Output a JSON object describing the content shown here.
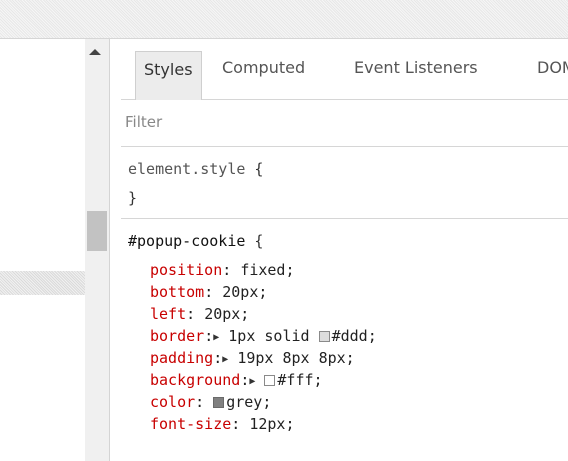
{
  "tabs": [
    {
      "label": "Styles"
    },
    {
      "label": "Computed"
    },
    {
      "label": "Event Listeners"
    },
    {
      "label": "DOM Breakpoints"
    }
  ],
  "filter": {
    "placeholder": "Filter",
    "value": ""
  },
  "element_style_rule": {
    "selector": "element.style",
    "open": " {",
    "close": "}"
  },
  "popup_rule": {
    "selector": "#popup-cookie",
    "open": " {",
    "declarations": [
      {
        "prop": "position",
        "value": "fixed;"
      },
      {
        "prop": "bottom",
        "value": "20px;"
      },
      {
        "prop": "left",
        "value": "20px;"
      },
      {
        "prop": "border",
        "value": "1px solid",
        "color_text": "#ddd;",
        "swatch_color": "#dddddd"
      },
      {
        "prop": "padding",
        "value": "19px 8px 8px;"
      },
      {
        "prop": "background",
        "color_text": "#fff;",
        "swatch_color": "#ffffff"
      },
      {
        "prop": "color",
        "color_text": "grey;",
        "swatch_color": "#808080"
      },
      {
        "prop": "font-size",
        "value": "12px;"
      }
    ]
  },
  "colors": {
    "property_name": "#c80000",
    "topbar_bg": "#eeeeee",
    "scroll_thumb": "#c2c2c2"
  },
  "icons": {
    "scroll_up": "triangle-up",
    "expand_arrow": "▶"
  },
  "punct": {
    "colon": ":",
    "colon_space": ": "
  }
}
